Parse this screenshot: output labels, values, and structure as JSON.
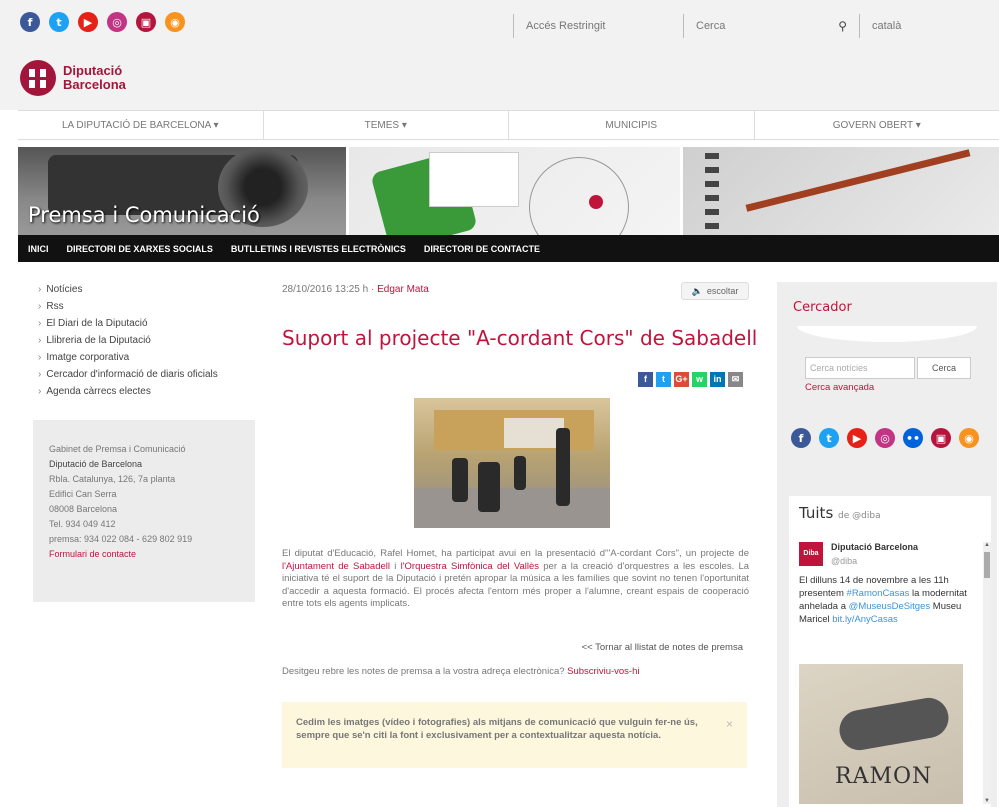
{
  "top": {
    "social": [
      {
        "icon": "facebook-icon",
        "glyph": "f",
        "color": "#3b5998"
      },
      {
        "icon": "twitter-icon",
        "glyph": "t",
        "color": "#1da1f2"
      },
      {
        "icon": "youtube-icon",
        "glyph": "▶",
        "color": "#e62117"
      },
      {
        "icon": "instagram-icon",
        "glyph": "◎",
        "color": "#c13584"
      },
      {
        "icon": "flickr-icon",
        "glyph": "▣",
        "color": "#b5143d"
      },
      {
        "icon": "rss-icon",
        "glyph": "◉",
        "color": "#f7931e"
      }
    ],
    "restricted_access": "Accés Restringit",
    "search_placeholder": "Cerca",
    "language": "català"
  },
  "logo": {
    "line1": "Diputació",
    "line2": "Barcelona",
    "color": "#a3163b"
  },
  "main_nav": [
    "LA DIPUTACIÓ DE BARCELONA ▾",
    "TEMES ▾",
    "MUNICIPIS",
    "GOVERN OBERT ▾"
  ],
  "banner": {
    "title": "Premsa i Comunicació"
  },
  "sub_nav": [
    "INICI",
    "DIRECTORI DE XARXES SOCIALS",
    "BUTLLETINS I REVISTES ELECTRÒNICS",
    "DIRECTORI DE CONTACTE"
  ],
  "left_nav": [
    "Notícies",
    "Rss",
    "El Diari de la Diputació",
    "Llibreria de la Diputació",
    "Imatge corporativa",
    "Cercador d'informació de diaris oficials",
    "Agenda càrrecs electes"
  ],
  "contact": {
    "dept": "Gabinet de Premsa i Comunicació",
    "org": "Diputació de Barcelona",
    "address1": "Rbla. Catalunya, 126, 7a planta",
    "address2": "Edifici Can Serra",
    "city": "08008 Barcelona",
    "phone": "Tel. 934 049 412",
    "press": "premsa: 934 022 084 - 629 802 919",
    "form_link": "Formulari de contacte"
  },
  "article": {
    "date": "28/10/2016 13:25 h",
    "separator": "·",
    "author": "Edgar Mata",
    "listen": "escoltar",
    "title": "Suport al projecte \"A-cordant Cors\" de Sabadell",
    "share": [
      {
        "icon": "facebook-share-icon",
        "glyph": "f",
        "color": "#3b5998"
      },
      {
        "icon": "twitter-share-icon",
        "glyph": "t",
        "color": "#1da1f2"
      },
      {
        "icon": "google-plus-share-icon",
        "glyph": "G+",
        "color": "#dd4b39"
      },
      {
        "icon": "whatsapp-share-icon",
        "glyph": "w",
        "color": "#25d366"
      },
      {
        "icon": "linkedin-share-icon",
        "glyph": "in",
        "color": "#0077b5"
      },
      {
        "icon": "email-share-icon",
        "glyph": "✉",
        "color": "#888888"
      }
    ],
    "body_1": "El diputat d'Educació, Rafel Homet, ha participat avui en la presentació d'\"A-cordant Cors\", un projecte de ",
    "link_1": "l'Ajuntament de Sabadell",
    "body_2": " i ",
    "link_2": "l'Orquestra Simfònica del Vallès",
    "body_3": " per a la creació d'orquestres a les escoles. La iniciativa té el suport de la Diputació i pretén apropar la música a les famílies que sovint no tenen l'oportunitat d'accedir a aquesta formació. El procés afecta l'entorn més proper a l'alumne, creant espais de cooperació entre tots els agents implicats.",
    "back": "<< Tornar al llistat de notes de premsa",
    "subscribe_text": "Desitgeu rebre les notes de premsa a la vostra adreça electrònica? ",
    "subscribe_link": "Subscriviu-vos-hi",
    "notice": "Cedim les imatges (vídeo i fotografies) als mitjans de comunicació que vulguin fer-ne ús, sempre que se'n citi la font i exclusivament per a contextualitzar aquesta notícia.",
    "notice_close": "×"
  },
  "sidebar": {
    "cercador_title": "Cercador",
    "search_placeholder": "Cerca notícies",
    "search_button": "Cerca",
    "advanced": "Cerca avançada",
    "social": [
      {
        "icon": "facebook-icon",
        "glyph": "f",
        "color": "#3b5998"
      },
      {
        "icon": "twitter-icon",
        "glyph": "t",
        "color": "#1da1f2"
      },
      {
        "icon": "youtube-icon",
        "glyph": "▶",
        "color": "#e62117"
      },
      {
        "icon": "instagram-icon",
        "glyph": "◎",
        "color": "#c13584"
      },
      {
        "icon": "flickr-icon",
        "glyph": "••",
        "color": "#0063dc"
      },
      {
        "icon": "dibamedia-icon",
        "glyph": "▣",
        "color": "#b5143d"
      },
      {
        "icon": "rss-icon",
        "glyph": "◉",
        "color": "#f7931e"
      }
    ],
    "tweets_title": "Tuits",
    "tweets_by": "de @diba",
    "tweet_avatar": "Diba",
    "tweet_name": "Diputació Barcelona",
    "tweet_handle": "@diba",
    "tweet_1": "El dilluns 14 de novembre a les 11h presentem ",
    "tweet_hashtag": "#RamonCasas",
    "tweet_2": " la modernitat anhelada a ",
    "tweet_mention": "@MuseusDeSitges",
    "tweet_3": " Museu Maricel ",
    "tweet_url": "bit.ly/AnyCasas",
    "tweet_image_text": "RAMON"
  }
}
